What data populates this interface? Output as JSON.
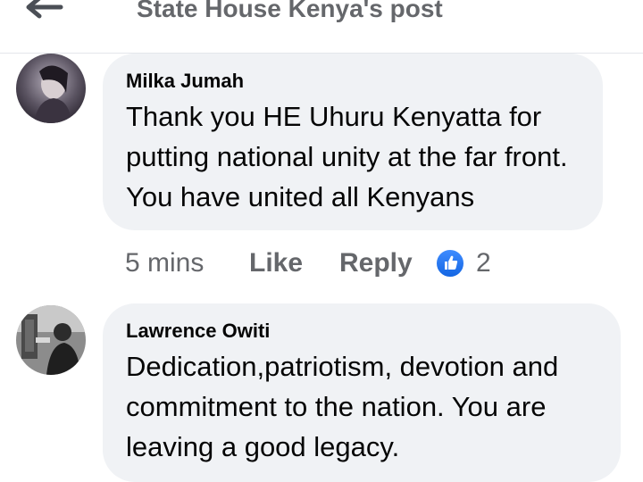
{
  "header": {
    "title": "State House Kenya's post"
  },
  "comments": [
    {
      "author": "Milka Jumah",
      "text": "Thank you HE Uhuru Kenyatta for putting national unity at the far front. You have united all Kenyans",
      "time": "5 mins",
      "like_label": "Like",
      "reply_label": "Reply",
      "reaction_count": "2",
      "reaction_icon": "like-thumb-icon"
    },
    {
      "author": "Lawrence Owiti",
      "text": "Dedication,patriotism, devotion and commitment to the nation. You are leaving a good legacy."
    }
  ],
  "colors": {
    "bubble": "#f0f2f5",
    "meta_text": "#65676b",
    "like_blue": "#1877f2"
  }
}
